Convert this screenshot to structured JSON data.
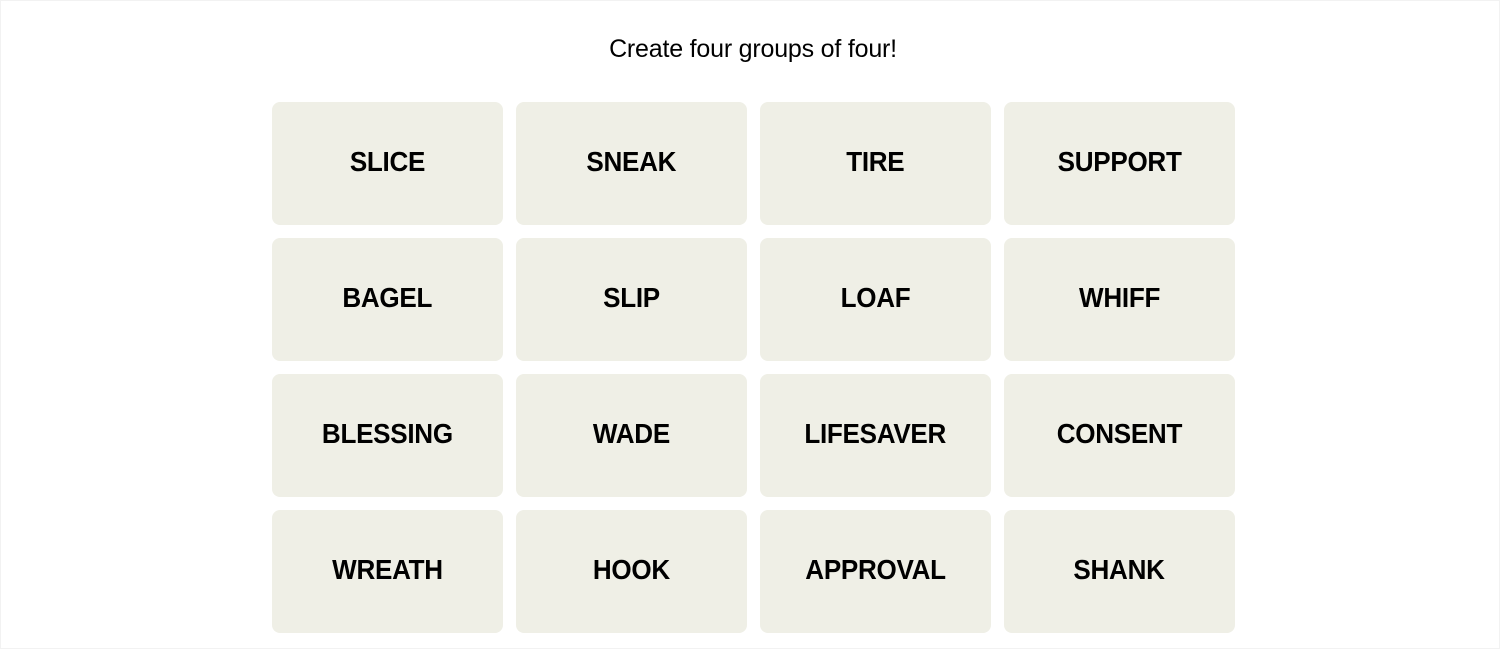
{
  "header": {
    "subtitle": "Create four groups of four!"
  },
  "board": {
    "tile_color": "#efefe6",
    "tiles": [
      {
        "word": "SLICE"
      },
      {
        "word": "SNEAK"
      },
      {
        "word": "TIRE"
      },
      {
        "word": "SUPPORT"
      },
      {
        "word": "BAGEL"
      },
      {
        "word": "SLIP"
      },
      {
        "word": "LOAF"
      },
      {
        "word": "WHIFF"
      },
      {
        "word": "BLESSING"
      },
      {
        "word": "WADE"
      },
      {
        "word": "LIFESAVER"
      },
      {
        "word": "CONSENT"
      },
      {
        "word": "WREATH"
      },
      {
        "word": "HOOK"
      },
      {
        "word": "APPROVAL"
      },
      {
        "word": "SHANK"
      }
    ]
  }
}
